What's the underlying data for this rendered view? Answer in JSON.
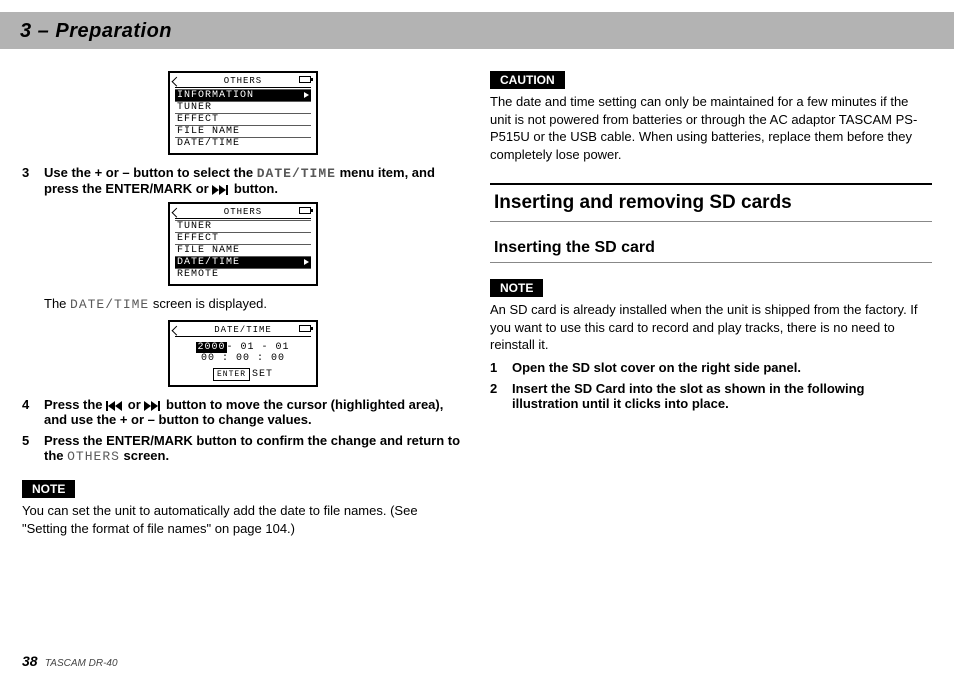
{
  "header": {
    "title": "3 – Preparation"
  },
  "lcd1": {
    "title": "OTHERS",
    "rows": [
      "INFORMATION",
      "TUNER",
      "EFFECT",
      "FILE NAME",
      "DATE/TIME"
    ],
    "selected": 0
  },
  "lcd2": {
    "title": "OTHERS",
    "rows": [
      "TUNER",
      "EFFECT",
      "FILE NAME",
      "DATE/TIME",
      "REMOTE"
    ],
    "selected": 3
  },
  "lcd3": {
    "title": "DATE/TIME",
    "year": "2000",
    "date_rest": "- 01 - 01",
    "time": "00 : 00 : 00",
    "enter_label": "ENTER",
    "set_label": "SET"
  },
  "left": {
    "step3_a": "Use the + or – button to select the ",
    "step3_mono": "DATE/TIME",
    "step3_b": " menu item, and press the ENTER/MARK or ",
    "step3_c": " button.",
    "after3_a": "The ",
    "after3_mono": "DATE/TIME",
    "after3_b": " screen is displayed.",
    "step4_a": "Press the ",
    "step4_b": " or ",
    "step4_c": " button to move the cursor (highlighted area), and use the + or – button to change values.",
    "step5_a": "Press the ENTER/MARK button to confirm the change and return to the ",
    "step5_mono": "OTHERS",
    "step5_b": " screen.",
    "note_tag": "NOTE",
    "note_body": "You can set the unit to automatically add the date to file names. (See \"Setting the format of file names\" on page 104.)"
  },
  "right": {
    "caution_tag": "CAUTION",
    "caution_body": "The date and time setting can only be maintained for a few minutes if the unit is not powered from batteries or through the AC adaptor TASCAM PS-P515U or the USB cable. When using batteries, replace them before they completely lose power.",
    "h2": "Inserting and removing SD cards",
    "h3": "Inserting the SD card",
    "note_tag": "NOTE",
    "note_body": "An SD card is already installed when the unit is shipped from the factory. If you want to use this card to record and play tracks, there is no need to reinstall it.",
    "step1": "Open the SD slot cover on the right side panel.",
    "step2": "Insert the SD Card into the slot as shown in the following illustration until it clicks into place."
  },
  "footer": {
    "page": "38",
    "model": "TASCAM DR-40"
  }
}
